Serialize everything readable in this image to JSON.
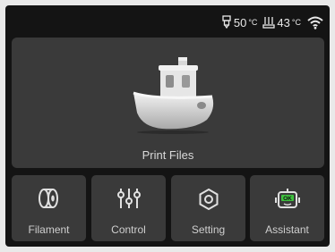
{
  "status": {
    "nozzle_temp": "50",
    "bed_temp": "43",
    "temp_unit": "°C",
    "wifi_icon": "wifi-icon"
  },
  "main": {
    "print_files_label": "Print Files"
  },
  "nav": {
    "items": [
      {
        "label": "Filament",
        "icon": "filament-spool-icon"
      },
      {
        "label": "Control",
        "icon": "sliders-icon"
      },
      {
        "label": "Setting",
        "icon": "hex-nut-icon"
      },
      {
        "label": "Assistant",
        "icon": "robot-ok-icon"
      }
    ]
  },
  "colors": {
    "background": "#141414",
    "card": "#3a3a3a",
    "text": "#d9d9d9"
  }
}
